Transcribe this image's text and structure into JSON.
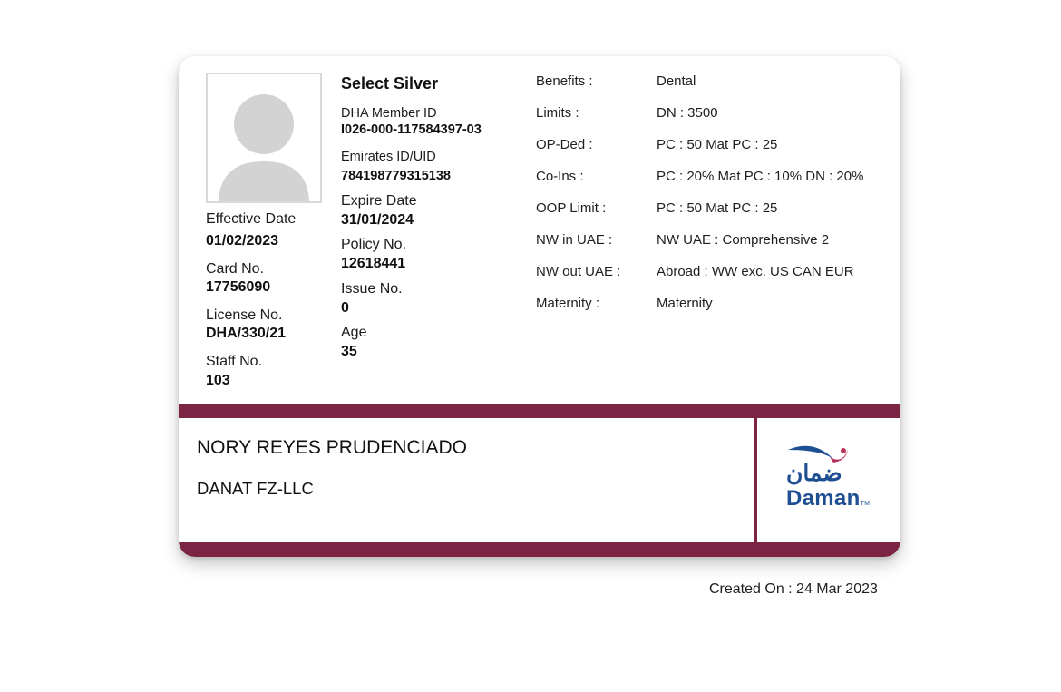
{
  "card": {
    "plan_name": "Select Silver",
    "left_column": [
      {
        "label": "Effective Date",
        "value": "01/02/2023"
      },
      {
        "label": "Card No.",
        "value": "17756090"
      },
      {
        "label": "License No.",
        "value": "DHA/330/21"
      },
      {
        "label": "Staff No.",
        "value": "103"
      }
    ],
    "middle_column": [
      {
        "label": "DHA Member ID",
        "value": "I026-000-117584397-03"
      },
      {
        "label": "Emirates ID/UID",
        "value": "784198779315138"
      },
      {
        "label": "Expire Date",
        "value": "31/01/2024"
      },
      {
        "label": "Policy No.",
        "value": "12618441"
      },
      {
        "label": "Issue No.",
        "value": "0"
      },
      {
        "label": "Age",
        "value": "35"
      }
    ],
    "benefits": [
      {
        "label": "Benefits :",
        "value": "Dental"
      },
      {
        "label": "Limits :",
        "value": "DN : 3500"
      },
      {
        "label": "OP-Ded :",
        "value": "PC : 50  Mat PC : 25"
      },
      {
        "label": "Co-Ins :",
        "value": "PC : 20%  Mat PC : 10%  DN : 20%"
      },
      {
        "label": "OOP Limit :",
        "value": "PC : 50  Mat PC : 25"
      },
      {
        "label": "NW in UAE :",
        "value": "NW UAE : Comprehensive 2"
      },
      {
        "label": "NW out UAE :",
        "value": "Abroad : WW exc. US CAN EUR"
      },
      {
        "label": "Maternity :",
        "value": "Maternity"
      }
    ],
    "member_name": "NORY REYES PRUDENCIADO",
    "company": "DANAT FZ-LLC",
    "logo": {
      "arabic": "ضمان",
      "english": "Daman",
      "tm": "TM"
    },
    "colors": {
      "band": "#7b2444",
      "logo_blue": "#1e4f92",
      "logo_accent": "#b8325a"
    }
  },
  "created_on": "Created On : 24 Mar 2023"
}
